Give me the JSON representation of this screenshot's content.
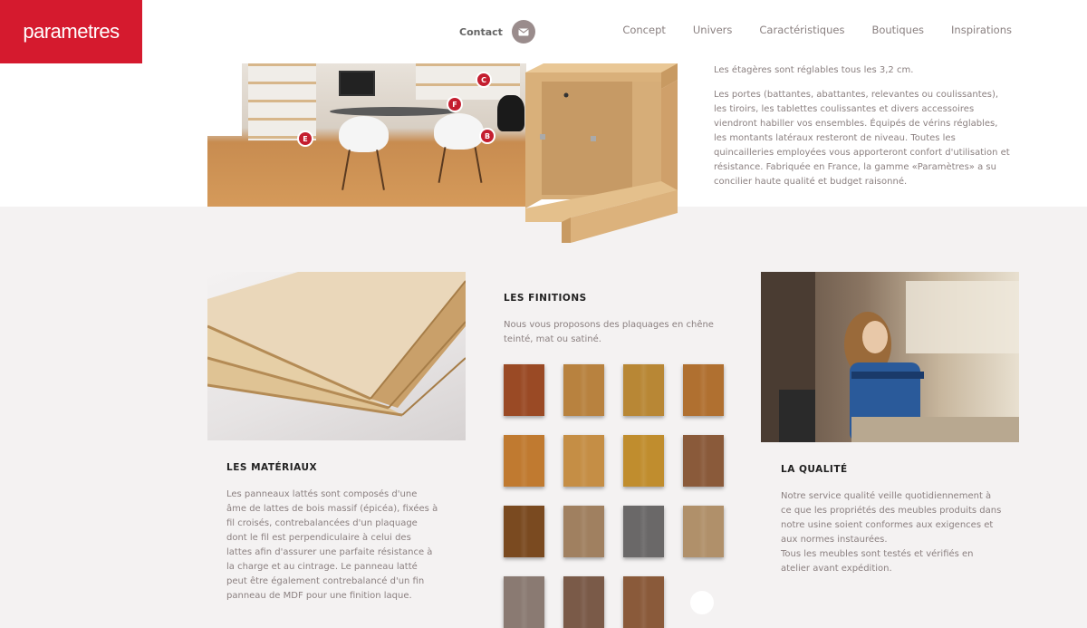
{
  "header": {
    "logo": "parametres",
    "contact_label": "Contact",
    "nav": [
      "Concept",
      "Univers",
      "Caractéristiques",
      "Boutiques",
      "Inspirations"
    ]
  },
  "top": {
    "markers": [
      "C",
      "F",
      "E",
      "B"
    ],
    "paragraph1": "Les étagères sont réglables tous les 3,2 cm.",
    "paragraph2": "Les portes (battantes, abattantes, relevantes ou coulissantes), les tiroirs, les tablettes coulissantes et divers accessoires viendront habiller vos ensembles. Équipés de vérins réglables, les montants latéraux resteront de niveau. Toutes les quincailleries employées vous apporteront confort d'utilisation et résistance. Fabriquée en France, la gamme «Paramètres» a su concilier haute qualité et budget raisonné."
  },
  "materiaux": {
    "title": "LES MATÉRIAUX",
    "text": "Les panneaux lattés sont composés d'une âme de lattes de bois massif (épicéa), fixées à fil croisés, contrebalancées d'un plaquage dont le fil est perpendiculaire à celui des lattes afin d'assurer une parfaite résistance à la charge et au cintrage. Le panneau latté peut être également contrebalancé d'un fin panneau de MDF pour une finition laque."
  },
  "finitions": {
    "title": "LES FINITIONS",
    "text": "Nous vous proposons des plaquages en chêne teinté, mat ou satiné.",
    "swatch_colors": [
      "#9a4a25",
      "#b8823f",
      "#b88735",
      "#b07030",
      "#c07a30",
      "#c58e45",
      "#c08d2e",
      "#8a5a3a",
      "#7a4a20",
      "#a08060",
      "#6a6868",
      "#b0906a",
      "#8a7a72",
      "#7a5a48",
      "#8a5a3a"
    ]
  },
  "qualite": {
    "title": "LA QUALITÉ",
    "text1": "Notre service qualité veille quotidiennement à ce que les propriétés des meubles produits dans notre usine soient conformes aux exigences et aux normes instaurées.",
    "text2": "Tous les meubles sont testés et vérifiés en atelier avant expédition."
  },
  "icons": {
    "mail": "mail-icon"
  }
}
